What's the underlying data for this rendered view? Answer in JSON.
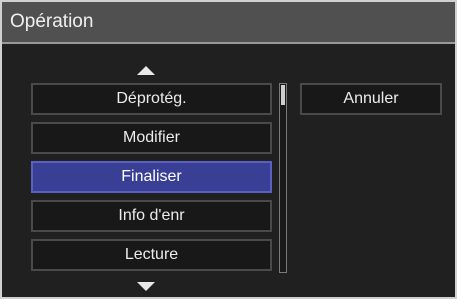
{
  "dialog": {
    "title": "Opération"
  },
  "menu": {
    "items": [
      {
        "label": "Déprotég.",
        "selected": false
      },
      {
        "label": "Modifier",
        "selected": false
      },
      {
        "label": "Finaliser",
        "selected": true
      },
      {
        "label": "Info d'enr",
        "selected": false
      },
      {
        "label": "Lecture",
        "selected": false
      }
    ]
  },
  "actions": {
    "cancel_label": "Annuler"
  },
  "icons": {
    "up": "triangle-up-icon",
    "down": "triangle-down-icon"
  },
  "colors": {
    "selected_bg": "#3a3f96",
    "title_bg": "#505050"
  }
}
